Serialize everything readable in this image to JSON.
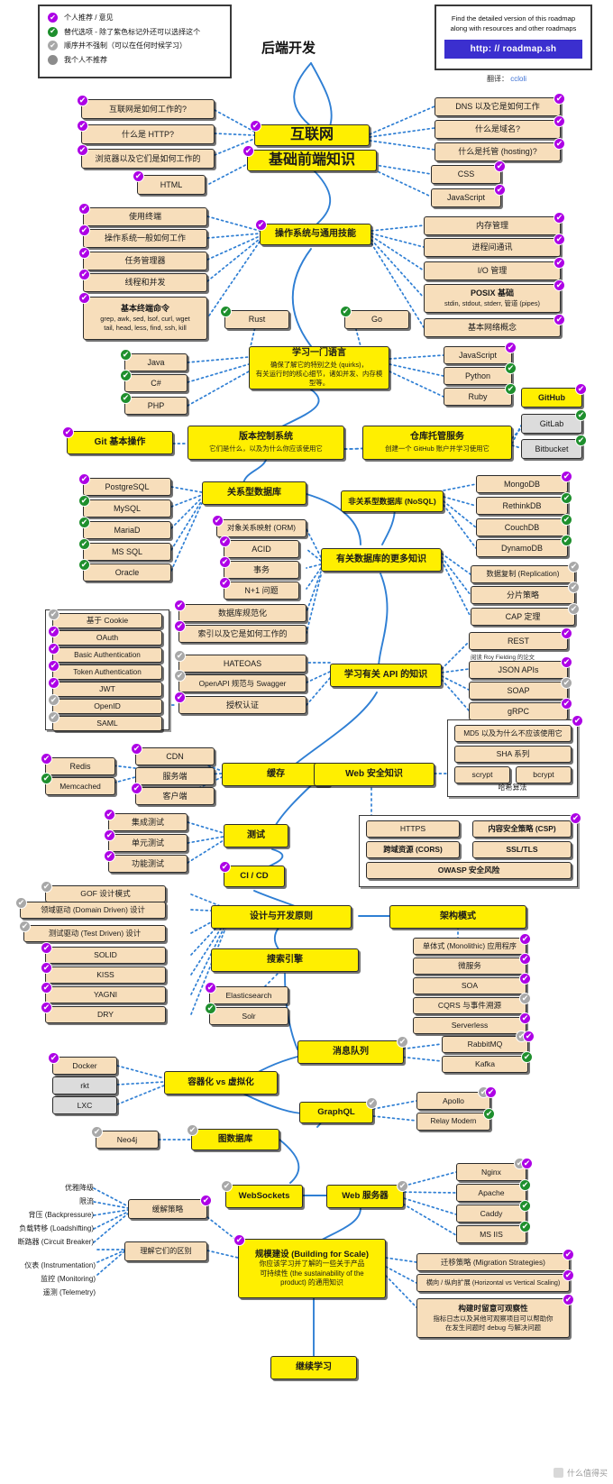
{
  "title": "后端开发",
  "translator": {
    "prefix": "翻译：",
    "name": "ccloli"
  },
  "watermark": "什么值得买",
  "legend": {
    "items": [
      {
        "marker": "purple-check",
        "label": "个人推荐 / 意见"
      },
      {
        "marker": "green-check",
        "label": "替代选项 - 除了紫色标记外还可以选择这个"
      },
      {
        "marker": "gray-check",
        "label": "顺序并不强制（可以在任何时候学习）"
      },
      {
        "marker": "gray-dot",
        "label": "我个人不推荐"
      }
    ]
  },
  "infobox": {
    "line1": "Find the detailed version of this roadmap",
    "line2": "along with resources and other roadmaps",
    "url": "http: // roadmap.sh"
  },
  "nodes": {
    "internet": "互联网",
    "frontend_basics": "基础前端知识",
    "how_internet_works": "互联网是如何工作的?",
    "what_is_http": "什么是 HTTP?",
    "browsers": "浏览器以及它们是如何工作的",
    "html": "HTML",
    "dns": "DNS 以及它是如何工作",
    "domain_name": "什么是域名?",
    "hosting": "什么是托管 (hosting)?",
    "css": "CSS",
    "javascript_front": "JavaScript",
    "os_skills": "操作系统与通用技能",
    "terminal_usage": "使用终端",
    "os_general": "操作系统一般如何工作",
    "task_manager": "任务管理器",
    "threads": "线程和并发",
    "basic_terminal_title": "基本终端命令",
    "basic_terminal_sub1": "grep, awk, sed, lsof, curl, wget",
    "basic_terminal_sub2": "tail, head, less, find, ssh, kill",
    "memory_mgmt": "内存管理",
    "ipc": "进程间通讯",
    "io_mgmt": "I/O 管理",
    "posix_title": "POSIX 基础",
    "posix_sub": "stdin, stdout, stderr, 管道 (pipes)",
    "networking_basics": "基本网络概念",
    "learn_lang_title": "学习一门语言",
    "learn_lang_sub1": "确保了解它的特别之处 (quirks)，",
    "learn_lang_sub2": "有关运行时的核心细节，诸如并发、内存模型等。",
    "rust": "Rust",
    "go": "Go",
    "java": "Java",
    "csharp": "C#",
    "php": "PHP",
    "javascript_lang": "JavaScript",
    "python": "Python",
    "ruby": "Ruby",
    "vcs_title": "版本控制系统",
    "vcs_sub": "它们是什么，以及为什么你应该使用它",
    "git_basics": "Git 基本操作",
    "repo_hosting_title": "仓库托管服务",
    "repo_hosting_sub": "创建一个 GitHub 账户并学习使用它",
    "github": "GitHub",
    "gitlab": "GitLab",
    "bitbucket": "Bitbucket",
    "rdbms": "关系型数据库",
    "postgresql": "PostgreSQL",
    "mysql": "MySQL",
    "mariadb": "MariaD",
    "mssql": "MS SQL",
    "oracle": "Oracle",
    "nosql": "非关系型数据库 (NoSQL)",
    "mongodb": "MongoDB",
    "rethinkdb": "RethinkDB",
    "couchdb": "CouchDB",
    "dynamodb": "DynamoDB",
    "more_db": "有关数据库的更多知识",
    "orm": "对象关系映射 (ORM)",
    "acid": "ACID",
    "transactions": "事务",
    "nplus1": "N+1 问题",
    "db_normalization": "数据库规范化",
    "indexes": "索引以及它是如何工作的",
    "replication": "数据复制 (Replication)",
    "sharding": "分片策略",
    "cap": "CAP 定理",
    "learn_api": "学习有关 API 的知识",
    "rest": "REST",
    "rest_note": "阅读 Roy Fielding 的论文",
    "json_apis": "JSON APIs",
    "soap": "SOAP",
    "grpc": "gRPC",
    "hateoas": "HATEOAS",
    "openapi": "OpenAPI 规范与 Swagger",
    "authentication": "授权认证",
    "cookie_based": "基于 Cookie",
    "oauth": "OAuth",
    "basic_auth": "Basic Authentication",
    "token_auth": "Token Authentication",
    "jwt": "JWT",
    "openid": "OpenID",
    "saml": "SAML",
    "caching": "缓存",
    "cdn": "CDN",
    "server_side": "服务端",
    "client_side": "客户端",
    "redis": "Redis",
    "memcached": "Memcached",
    "web_security": "Web 安全知识",
    "hashing_label": "哈希算法",
    "md5": "MD5 以及为什么不应该使用它",
    "sha": "SHA 系列",
    "scrypt": "scrypt",
    "bcrypt": "bcrypt",
    "https": "HTTPS",
    "csp": "内容安全策略 (CSP)",
    "cors": "跨域资源 (CORS)",
    "ssl_tls": "SSL/TLS",
    "owasp": "OWASP 安全风险",
    "testing": "测试",
    "integration_test": "集成测试",
    "unit_test": "单元测试",
    "functional_test": "功能测试",
    "cicd": "CI / CD",
    "design_dev": "设计与开发原则",
    "gof": "GOF 设计模式",
    "ddd": "领域驱动 (Domain Driven) 设计",
    "tdd": "测试驱动 (Test Driven) 设计",
    "solid": "SOLID",
    "kiss": "KISS",
    "yagni": "YAGNI",
    "dry": "DRY",
    "arch_patterns": "架构模式",
    "monolithic": "单体式 (Monolithic) 应用程序",
    "microservices": "微服务",
    "soa": "SOA",
    "cqrs": "CQRS 与事件溯源",
    "serverless": "Serverless",
    "search_engine": "搜索引擎",
    "elasticsearch": "Elasticsearch",
    "solr": "Solr",
    "message_queue": "消息队列",
    "rabbitmq": "RabbitMQ",
    "kafka": "Kafka",
    "containers": "容器化 vs 虚拟化",
    "docker": "Docker",
    "rkt": "rkt",
    "lxc": "LXC",
    "graphql": "GraphQL",
    "apollo": "Apollo",
    "relay": "Relay Modern",
    "graph_db": "图数据库",
    "neo4j": "Neo4j",
    "websockets": "WebSockets",
    "web_server": "Web 服务器",
    "nginx": "Nginx",
    "apache": "Apache",
    "caddy": "Caddy",
    "msiis": "MS IIS",
    "mitigation": "缓解策略",
    "graceful_degradation": "优雅降级",
    "throttling": "限流",
    "backpressure": "背压 (Backpressure)",
    "loadshifting": "负载转移 (Loadshifting)",
    "circuit_breaker": "断路器 (Circuit Breaker)",
    "instrumentation": "仪表 (Instrumentation)",
    "monitoring": "监控 (Monitoring)",
    "telemetry": "遥测 (Telemetry)",
    "understand_diff": "理解它们的区别",
    "building_scale_title": "规模建设 (Building for Scale)",
    "building_scale_sub1": "你应该学习并了解的一些关于产品",
    "building_scale_sub2": "可持续性 (the sustainability of the",
    "building_scale_sub3": "product) 的通用知识",
    "migration": "迁移策略 (Migration Strategies)",
    "scaling": "横向 / 纵向扩展 (Horizontal vs Vertical Scaling)",
    "observability_title": "构建时留意可观察性",
    "observability_sub1": "指标日志以及其他可观察项目可以帮助你",
    "observability_sub2": "在发生问题时 debug 与解决问题",
    "keep_learning": "继续学习"
  },
  "colors": {
    "yellow": "#ffef00",
    "tan": "#f7debb",
    "gray": "#dcdcdc",
    "purple": "#ad00e6",
    "green": "#1e8f2d",
    "edge_blue": "#2f7fd4",
    "url_bg": "#3b2fcf"
  }
}
